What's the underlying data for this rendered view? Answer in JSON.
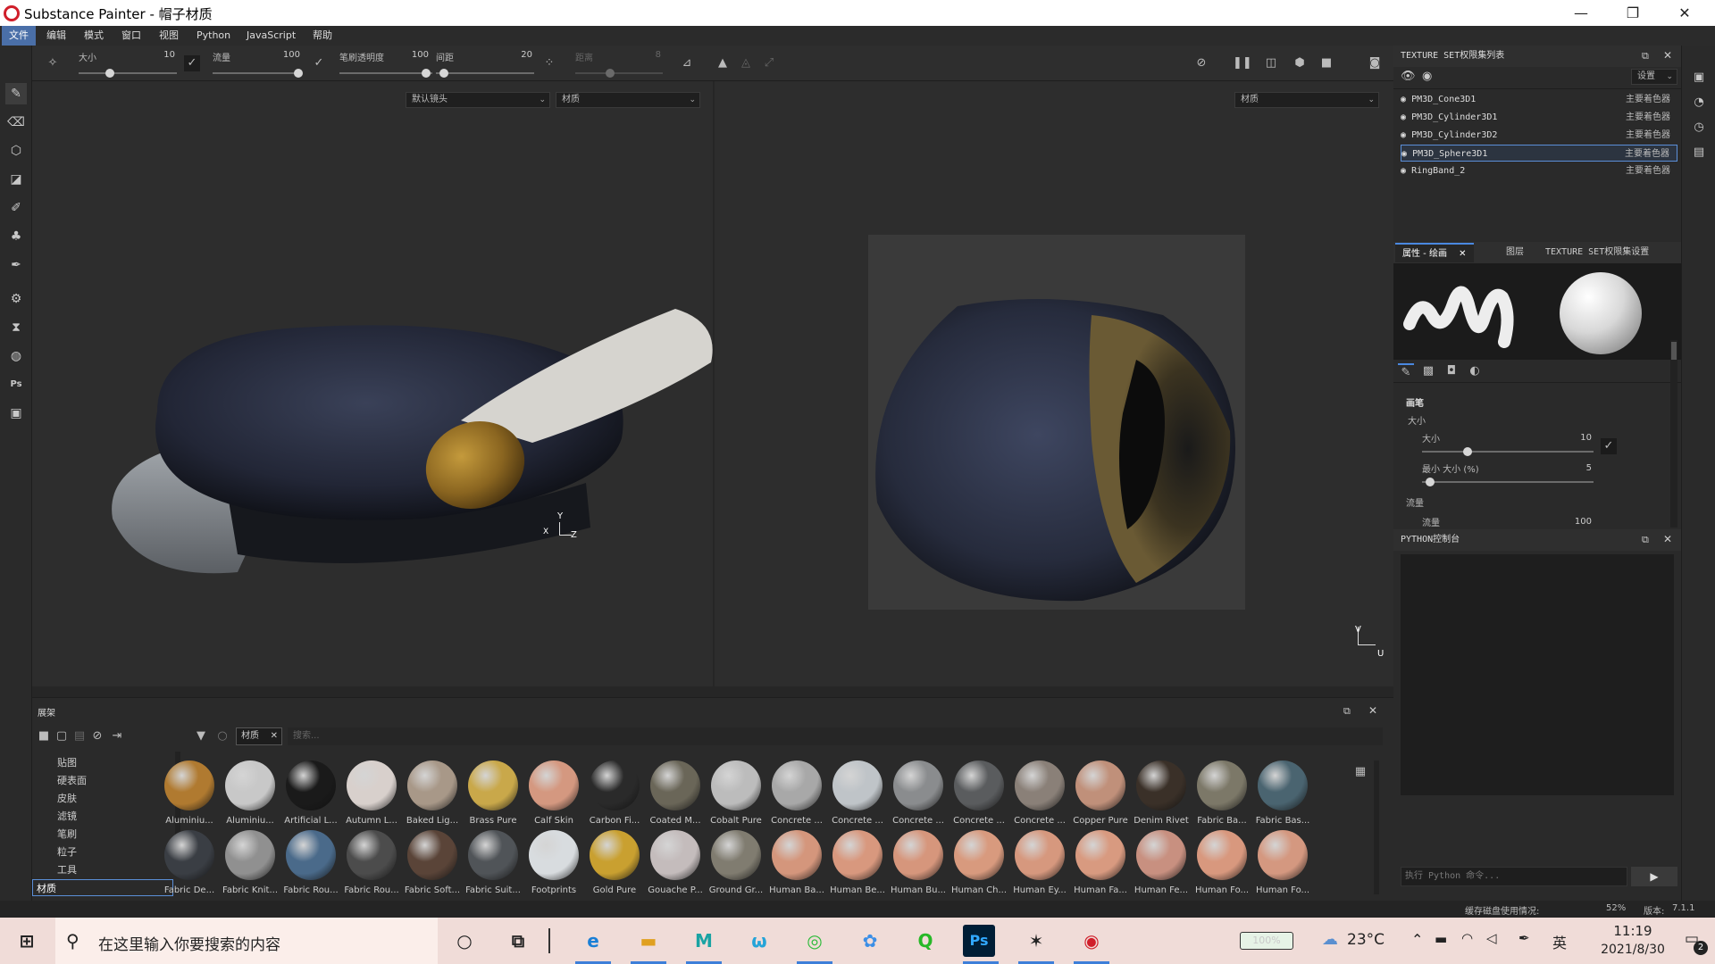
{
  "titlebar": {
    "title": "Substance Painter - 帽子材质",
    "min": "—",
    "max": "❐",
    "close": "✕"
  },
  "menu": [
    "文件",
    "编辑",
    "模式",
    "窗口",
    "视图",
    "Python",
    "JavaScript",
    "帮助"
  ],
  "toolbar_options": {
    "size_label": "大小",
    "size_value": "10",
    "flow_label": "流量",
    "flow_value": "100",
    "opacity_label": "笔刷透明度",
    "opacity_value": "100",
    "spacing_label": "间距",
    "spacing_value": "20",
    "distance_label": "距离",
    "distance_value": "8"
  },
  "viewport3d": {
    "camera_select": "默认镜头",
    "material_select": "材质",
    "axis_y": "Y",
    "axis_z": "Z",
    "axis_x": "X"
  },
  "viewport2d": {
    "material_select": "材质",
    "axis_v": "V",
    "axis_u": "U"
  },
  "texture_set_panel": {
    "title": "TEXTURE SET权限集列表",
    "settings": "设置",
    "sets": [
      {
        "name": "PM3D_Cone3D1",
        "shader": "主要着色器"
      },
      {
        "name": "PM3D_Cylinder3D1",
        "shader": "主要着色器"
      },
      {
        "name": "PM3D_Cylinder3D2",
        "shader": "主要着色器"
      },
      {
        "name": "PM3D_Sphere3D1",
        "shader": "主要着色器"
      },
      {
        "name": "RingBand_2",
        "shader": "主要着色器"
      }
    ]
  },
  "properties_panel": {
    "tabs": [
      "属性 - 绘画",
      "图层",
      "TEXTURE SET权限集设置"
    ],
    "section_brush": "画笔",
    "size_heading": "大小",
    "size_label": "大小",
    "size_value": "10",
    "min_size_label": "最小 大小 (%)",
    "min_size_value": "5",
    "flow_heading": "流量",
    "flow_label": "流量",
    "flow_value": "100"
  },
  "python_console": {
    "title": "PYTHON控制台",
    "placeholder": "执行 Python 命令..."
  },
  "shelf": {
    "title": "展架",
    "filter_tag": "材质",
    "search_placeholder": "搜索...",
    "categories": [
      "贴图",
      "硬表面",
      "皮肤",
      "滤镜",
      "笔刷",
      "粒子",
      "工具",
      "材质"
    ],
    "materials_row1": [
      "Aluminiu...",
      "Aluminiu...",
      "Artificial L...",
      "Autumn L...",
      "Baked Lig...",
      "Brass Pure",
      "Calf Skin",
      "Carbon Fi...",
      "Coated M...",
      "Cobalt Pure",
      "Concrete ...",
      "Concrete ...",
      "Concrete ...",
      "Concrete ...",
      "Concrete ...",
      "Copper Pure",
      "Denim Rivet",
      "Fabric Ba...",
      "Fabric Bas..."
    ],
    "materials_row2": [
      "Fabric De...",
      "Fabric Knit...",
      "Fabric Rou...",
      "Fabric Rou...",
      "Fabric Soft...",
      "Fabric Suit...",
      "Footprints",
      "Gold Pure",
      "Gouache P...",
      "Ground Gr...",
      "Human Ba...",
      "Human Be...",
      "Human Bu...",
      "Human Ch...",
      "Human Ey...",
      "Human Fa...",
      "Human Fe...",
      "Human Fo...",
      "Human Fo..."
    ],
    "colors_row1": [
      "#b07a30",
      "#c8c8c8",
      "#1a1a1a",
      "#d8d0cc",
      "#a89888",
      "#c9a84a",
      "#d49880",
      "#2a2a2a",
      "#6a6658",
      "#bcbcbc",
      "#a8a8a8",
      "#bfc4c8",
      "#8a8c8e",
      "#5a5c5e",
      "#8a8078",
      "#c0907a",
      "#3a3028",
      "#7c7868",
      "#4a6470"
    ],
    "colors_row2": [
      "#3a3e44",
      "#909090",
      "#4a6a8a",
      "#4c4c4c",
      "#5a4438",
      "#505458",
      "#d8dcdf",
      "#c9a030",
      "#c4bcbc",
      "#807c70",
      "#d4967c",
      "#d8987e",
      "#d6967c",
      "#d89a7e",
      "#d6987e",
      "#d89a80",
      "#c89080",
      "#d8987e",
      "#d49880"
    ]
  },
  "status": {
    "cache_label": "缓存磁盘使用情况:",
    "cache_value": "52%",
    "version_label": "版本:",
    "version_value": "7.1.1"
  },
  "taskbar": {
    "search_placeholder": "在这里输入你要搜索的内容",
    "battery": "100%",
    "temperature": "23°C",
    "ime": "英",
    "time": "11:19",
    "date": "2021/8/30",
    "notifications": "2"
  }
}
